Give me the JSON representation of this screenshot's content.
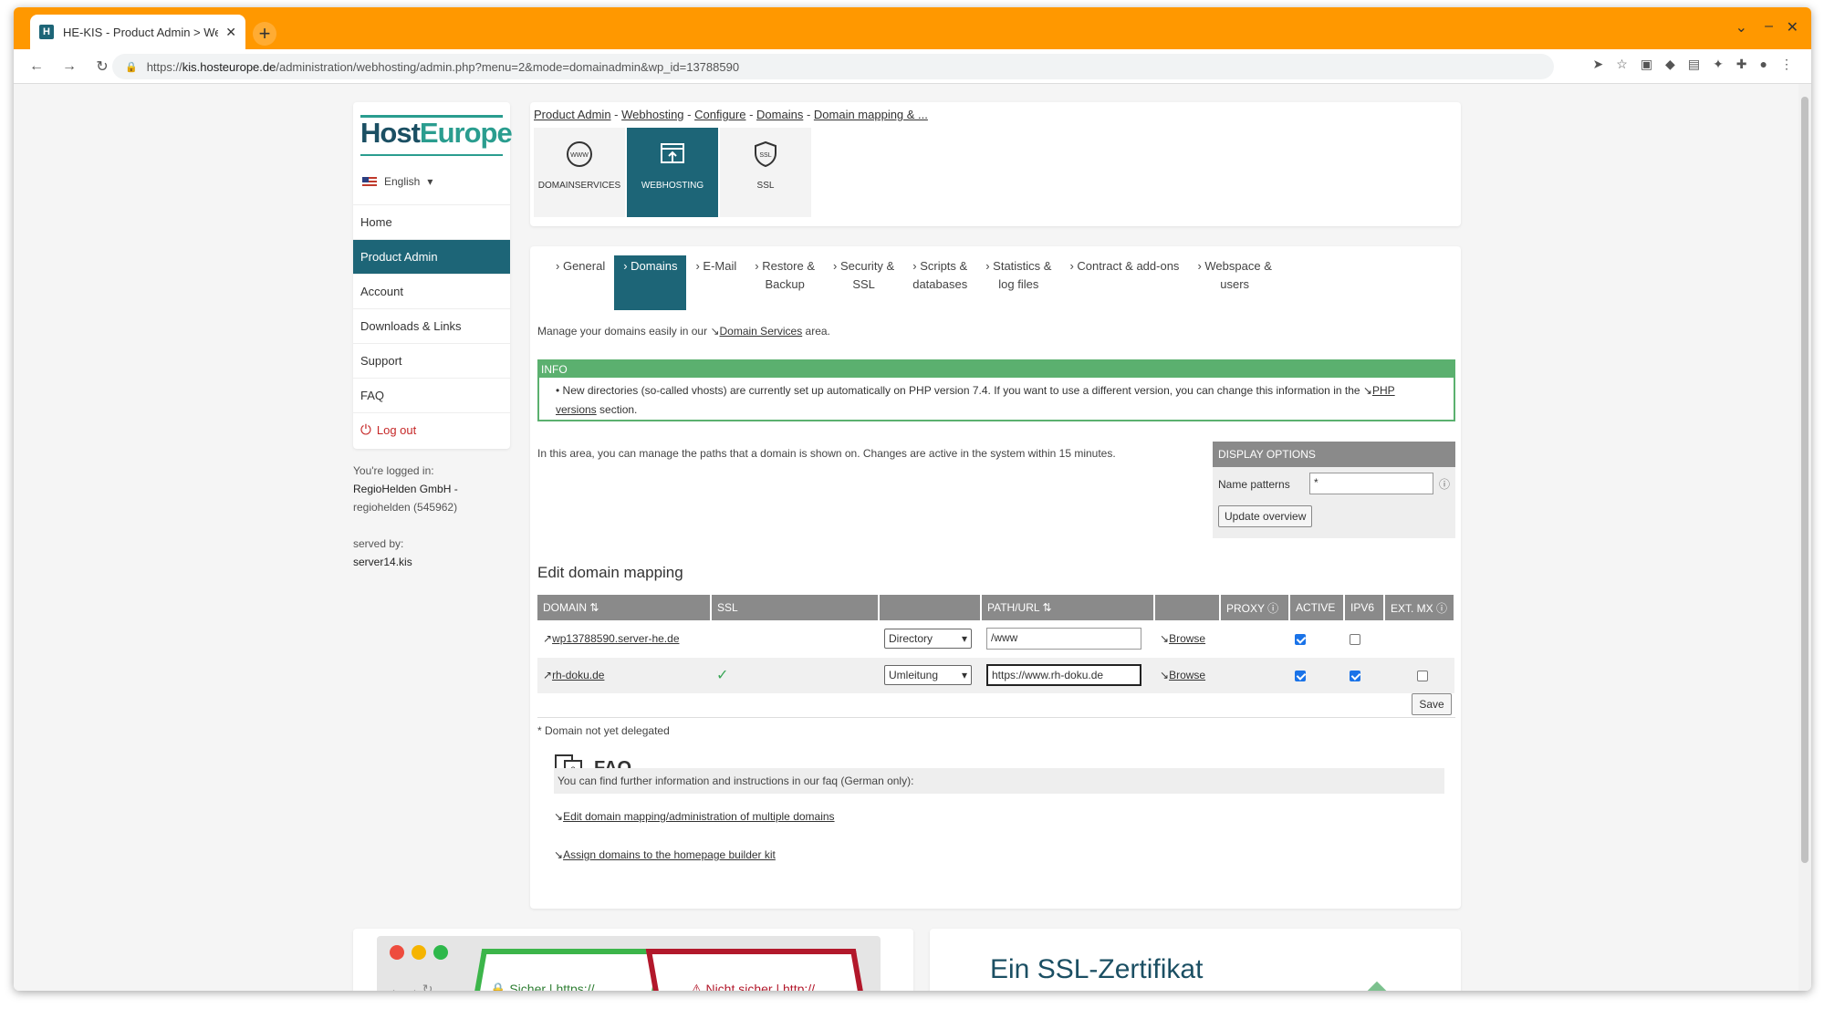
{
  "browser": {
    "tab_title": "HE-KIS - Product Admin > We",
    "tab_favicon": "H",
    "new_tab": "+",
    "url_prefix": "https://",
    "url_host": "kis.hosteurope.de",
    "url_path": "/administration/webhosting/admin.php?menu=2&mode=domainadmin&wp_id=13788590"
  },
  "sidebar": {
    "logo_host": "Host",
    "logo_europe": "Europe",
    "language": "English",
    "items": [
      {
        "label": "Home"
      },
      {
        "label": "Product Admin"
      },
      {
        "label": "Account"
      },
      {
        "label": "Downloads & Links"
      },
      {
        "label": "Support"
      },
      {
        "label": "FAQ"
      },
      {
        "label": "Log out"
      }
    ],
    "logged_in_label": "You're logged in:",
    "company": "RegioHelden GmbH -",
    "account": "regiohelden (545962)",
    "served_by_label": "served by:",
    "server": "server14.kis"
  },
  "breadcrumb": [
    "Product Admin",
    "Webhosting",
    "Configure",
    "Domains",
    "Domain mapping & ..."
  ],
  "services": [
    {
      "label": "DOMAINSERVICES",
      "icon": "www-globe-icon"
    },
    {
      "label": "WEBHOSTING",
      "icon": "webhosting-icon"
    },
    {
      "label": "SSL",
      "icon": "ssl-shield-icon"
    }
  ],
  "subtabs": [
    {
      "label1": "General",
      "label2": ""
    },
    {
      "label1": "Domains",
      "label2": ""
    },
    {
      "label1": "E-Mail",
      "label2": ""
    },
    {
      "label1": "Restore &",
      "label2": "Backup"
    },
    {
      "label1": "Security &",
      "label2": "SSL"
    },
    {
      "label1": "Scripts &",
      "label2": "databases"
    },
    {
      "label1": "Statistics &",
      "label2": "log files"
    },
    {
      "label1": "Contract & add-ons",
      "label2": ""
    },
    {
      "label1": "Webspace &",
      "label2": "users"
    }
  ],
  "intro": {
    "text_before": "Manage your domains easily in our ",
    "link": "Domain Services",
    "text_after": " area."
  },
  "info": {
    "heading": "INFO",
    "text": "New directories (so-called vhosts) are currently set up automatically on PHP version 7.4. If you want to use a different version, you can change this information in the ",
    "link": "PHP versions",
    "text_after": " section."
  },
  "area_text": "In this area, you can manage the paths that a domain is shown on. Changes are active in the system within 15 minutes.",
  "display_options": {
    "heading": "DISPLAY OPTIONS",
    "name_patterns_label": "Name patterns",
    "name_patterns_value": "*",
    "update_button": "Update overview"
  },
  "mapping": {
    "title": "Edit domain mapping",
    "columns": [
      "DOMAIN ⇅",
      "SSL",
      "",
      "PATH/URL ⇅",
      "",
      "PROXY ⓘ",
      "ACTIVE",
      "IPV6",
      "EXT. MX ⓘ"
    ],
    "rows": [
      {
        "domain": "wp13788590.server-he.de",
        "ssl": "",
        "type": "Directory",
        "path": "/www",
        "browse": "Browse",
        "active": true,
        "ipv6": false,
        "extmx": null
      },
      {
        "domain": "rh-doku.de",
        "ssl": "✓",
        "type": "Umleitung",
        "path": "https://www.rh-doku.de",
        "browse": "Browse",
        "active": true,
        "ipv6": true,
        "extmx": false
      }
    ],
    "save_button": "Save",
    "note": "* Domain not yet delegated"
  },
  "faq": {
    "title": "FAQ",
    "intro": "You can find further information and instructions in our faq (German only):",
    "links": [
      "Edit domain mapping/administration of multiple domains",
      "Assign domains to the homepage builder kit"
    ]
  },
  "promo": {
    "secure_label": "Sicher",
    "secure_url": "https://",
    "insecure_label": "Nicht sicher",
    "insecure_url": "http://",
    "ssl_headline": "Ein SSL-Zertifikat"
  },
  "colors": {
    "accent": "#1d6577",
    "tabbar": "#ff9800",
    "info": "#5bb06f"
  }
}
